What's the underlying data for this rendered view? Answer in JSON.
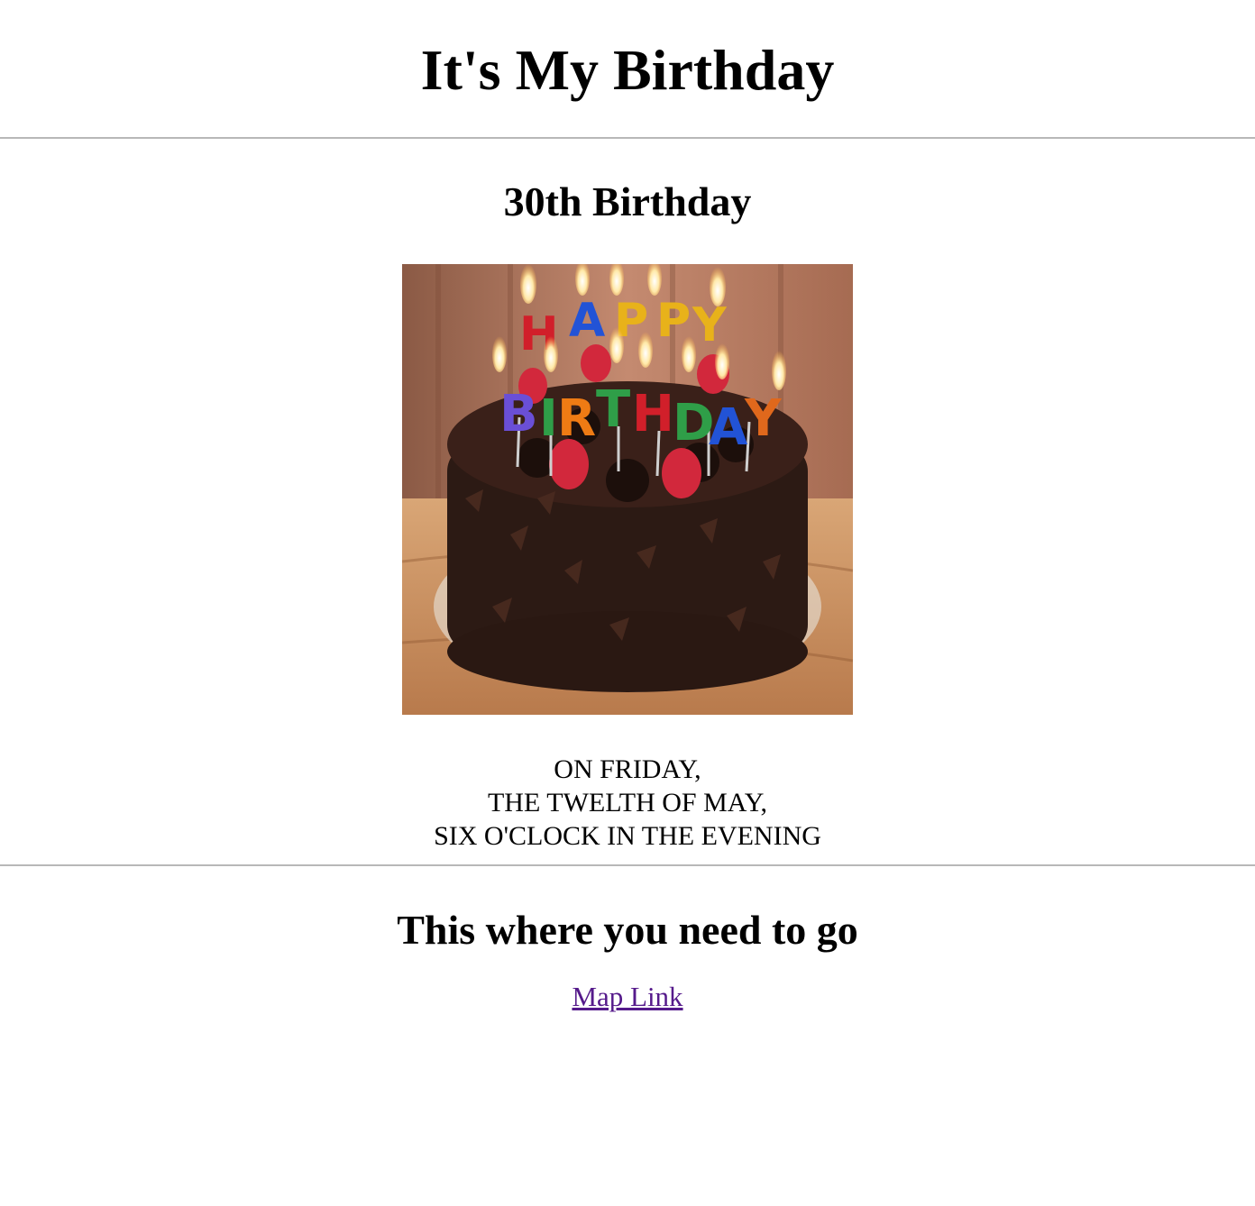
{
  "header": {
    "title": "It's My Birthday"
  },
  "event": {
    "heading": "30th Birthday",
    "image_icon": "birthday-cake-photo",
    "details": [
      "ON FRIDAY,",
      "THE TWELTH OF MAY,",
      "SIX O'CLOCK IN THE EVENING"
    ]
  },
  "directions": {
    "heading": "This where you need to go",
    "link_label": "Map Link"
  },
  "colors": {
    "link_visited": "#551a8b",
    "rule": "#b8b8b8"
  }
}
